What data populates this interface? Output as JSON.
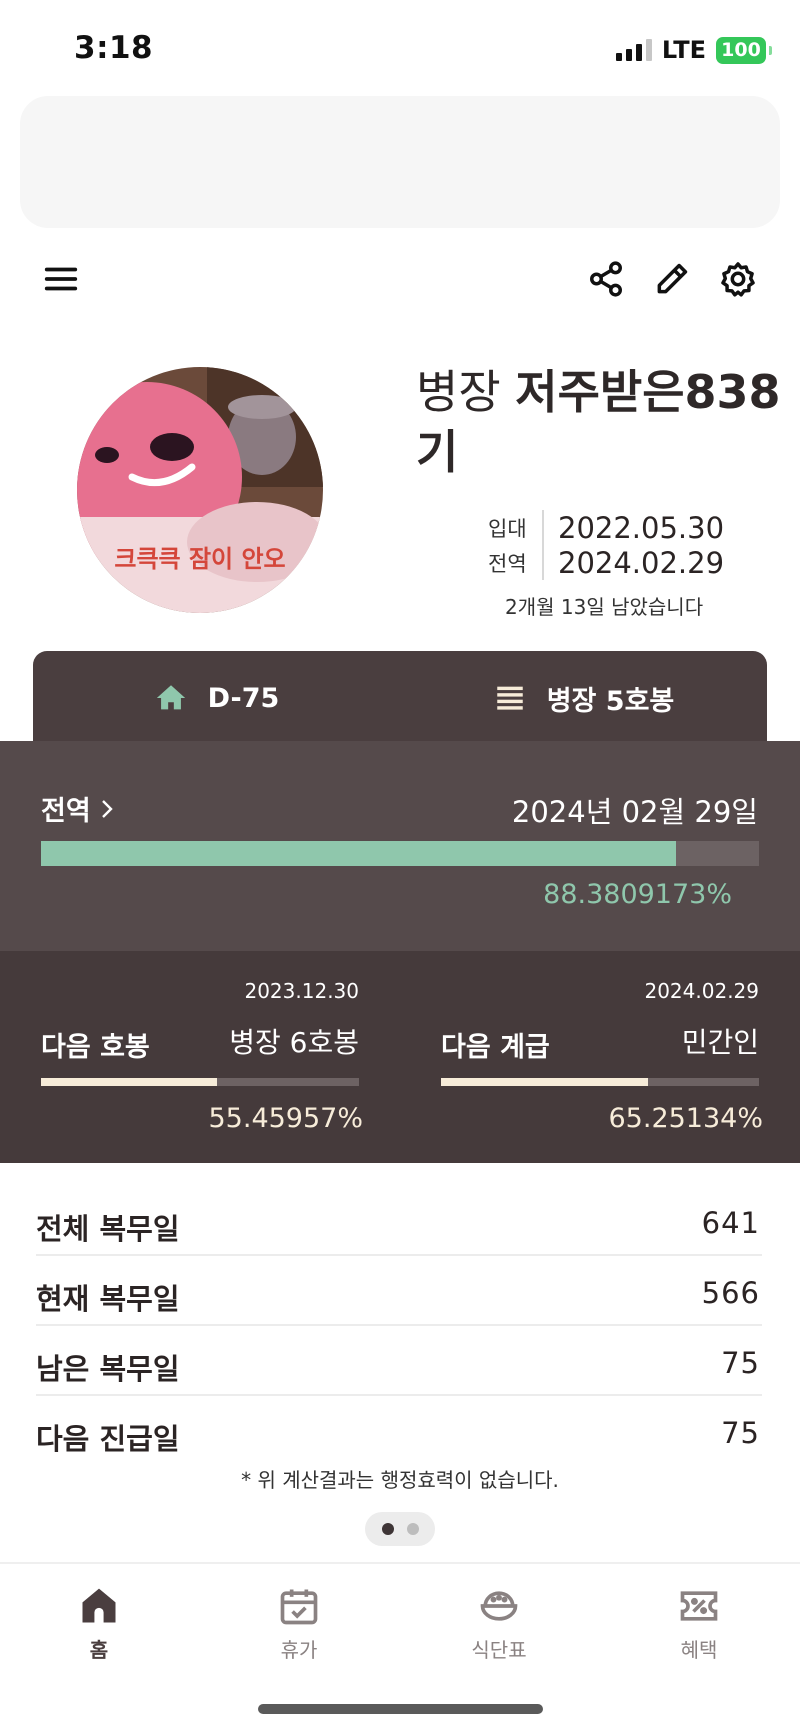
{
  "status_bar": {
    "time": "3:18",
    "network": "LTE",
    "battery": "100"
  },
  "toolbar": {
    "menu_icon": "menu-icon",
    "share_icon": "share-icon",
    "edit_icon": "pencil-icon",
    "settings_icon": "gear-icon"
  },
  "profile": {
    "rank": "병장",
    "nickname": "저주받은838기",
    "avatar_caption": "크큭큭 잠이 안오",
    "enlist_label": "입대",
    "enlist_date": "2022.05.30",
    "discharge_label": "전역",
    "discharge_date": "2024.02.29",
    "remaining_text": "2개월 13일 남았습니다"
  },
  "tabs": [
    {
      "label": "D-75",
      "icon": "home-icon"
    },
    {
      "label": "병장 5호봉",
      "icon": "list-icon"
    }
  ],
  "discharge": {
    "title": "전역",
    "date_text": "2024년 02월 29일",
    "progress": 88.3809173,
    "progress_text": "88.3809173%"
  },
  "next_pay": {
    "label": "다음 호봉",
    "date": "2023.12.30",
    "target": "병장 6호봉",
    "progress": 55.45957,
    "progress_text": "55.45957%"
  },
  "next_rank": {
    "label": "다음 계급",
    "date": "2024.02.29",
    "target": "민간인",
    "progress": 65.25134,
    "progress_text": "65.25134%"
  },
  "stats": [
    {
      "label": "전체 복무일",
      "value": "641"
    },
    {
      "label": "현재 복무일",
      "value": "566"
    },
    {
      "label": "남은 복무일",
      "value": "75"
    },
    {
      "label": "다음 진급일",
      "value": "75"
    }
  ],
  "disclaimer": "* 위 계산결과는 행정효력이 없습니다.",
  "pager": {
    "pages": 2,
    "active": 0
  },
  "bottom_nav": [
    {
      "label": "홈",
      "icon": "home-icon",
      "active": true
    },
    {
      "label": "휴가",
      "icon": "calendar-icon",
      "active": false
    },
    {
      "label": "식단표",
      "icon": "rice-bowl-icon",
      "active": false
    },
    {
      "label": "혜택",
      "icon": "coupon-icon",
      "active": false
    }
  ],
  "colors": {
    "dark_brown": "#4a3e3f",
    "mid_brown": "#554a4b",
    "mint": "#8fc7ac",
    "cream": "#f7ecd9"
  }
}
